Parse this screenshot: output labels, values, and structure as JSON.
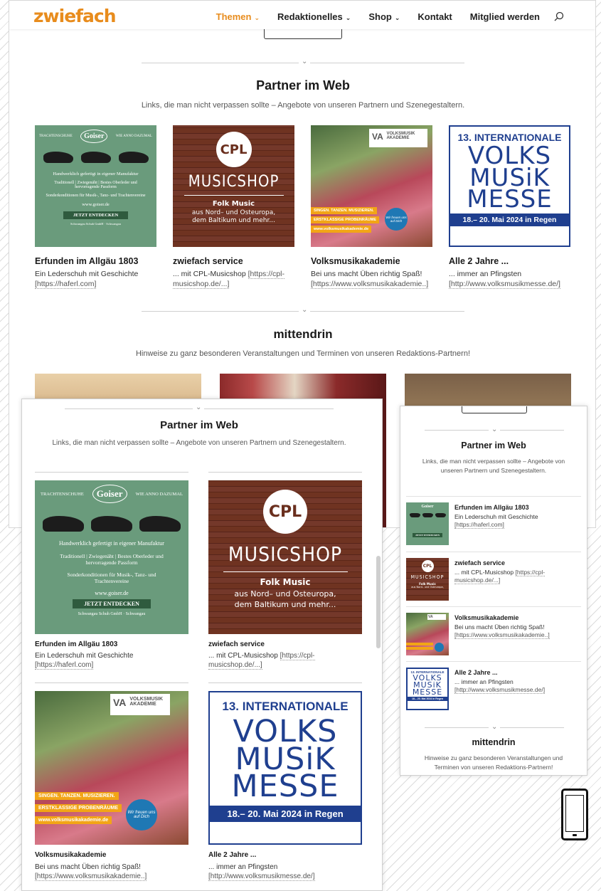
{
  "site": {
    "logo": "zwiefach",
    "nav": [
      {
        "label": "Themen",
        "active": true,
        "has_dropdown": true
      },
      {
        "label": "Redaktionelles",
        "active": false,
        "has_dropdown": true
      },
      {
        "label": "Shop",
        "active": false,
        "has_dropdown": true
      },
      {
        "label": "Kontakt",
        "active": false,
        "has_dropdown": false
      },
      {
        "label": "Mitglied werden",
        "active": false,
        "has_dropdown": false
      }
    ]
  },
  "partner": {
    "title": "Partner im Web",
    "subtitle": "Links, die man nicht verpassen sollte – Angebote von unseren Partnern und Szenegestaltern.",
    "cards": [
      {
        "title": "Erfunden im Allgäu 1803",
        "desc": "Ein Lederschuh mit Geschichte",
        "link": "[https://haferl.com]"
      },
      {
        "title": "zwiefach service",
        "desc": "... mit CPL-Musicshop",
        "link": "[https://cpl-musicshop.de/...]"
      },
      {
        "title": "Volksmusikakademie",
        "desc": "Bei uns macht Üben richtig Spaß!",
        "link": "[https://www.volksmusikakademie..]"
      },
      {
        "title": "Alle 2 Jahre ...",
        "desc": "... immer an Pfingsten",
        "link": "[http://www.volksmusikmesse.de/]"
      }
    ]
  },
  "mittendrin": {
    "title": "mittendrin",
    "subtitle": "Hinweise zu ganz besonderen Veranstaltungen und Terminen von unseren Redaktions-Partnern!"
  },
  "ads": {
    "goiser": {
      "left": "TRACHTENSCHUHE",
      "brand": "Goiser",
      "right": "WIE ANNO DAZUMAL",
      "line1": "Handwerklich gefertigt in eigener Manufaktur",
      "line2": "Traditionell | Zwiegenäht | Bestes Oberleder und hervorragende Passform",
      "line3": "Sonderkonditionen für Musik-, Tanz- und Trachtenvereine",
      "url": "www.goiser.de",
      "button": "JETZT ENTDECKEN",
      "footer": "Schwangau Schuh GmbH · Schwangau"
    },
    "cpl": {
      "badge": "CPL",
      "shop": "MUSICSHOP",
      "line1": "Folk Music",
      "line2": "aus Nord– und Osteuropa,",
      "line3": "dem Baltikum und mehr..."
    },
    "vma": {
      "logo_mark": "VA",
      "logo_text1": "VOLKSMUSIK",
      "logo_text2": "AKADEMIE",
      "strip1": "SINGEN. TANZEN. MUSIZIEREN.",
      "strip2": "ERSTKLASSIGE PROBENRÄUME",
      "strip3": "www.volksmusikakademie.de",
      "circle": "Wir freuen uns auf Dich"
    },
    "messe": {
      "header": "13. INTERNATIONALE",
      "line1": "VOLKS",
      "line2": "MUSiK",
      "line3": "MESSE",
      "footer": "18.– 20. Mai 2024 in Regen"
    }
  },
  "colors": {
    "accent": "#e88c1d",
    "goiser_green": "#6a9b7c",
    "cpl_wood": "#6a2f1e",
    "messe_blue": "#1f3f8f",
    "vma_orange": "#f2a516"
  }
}
